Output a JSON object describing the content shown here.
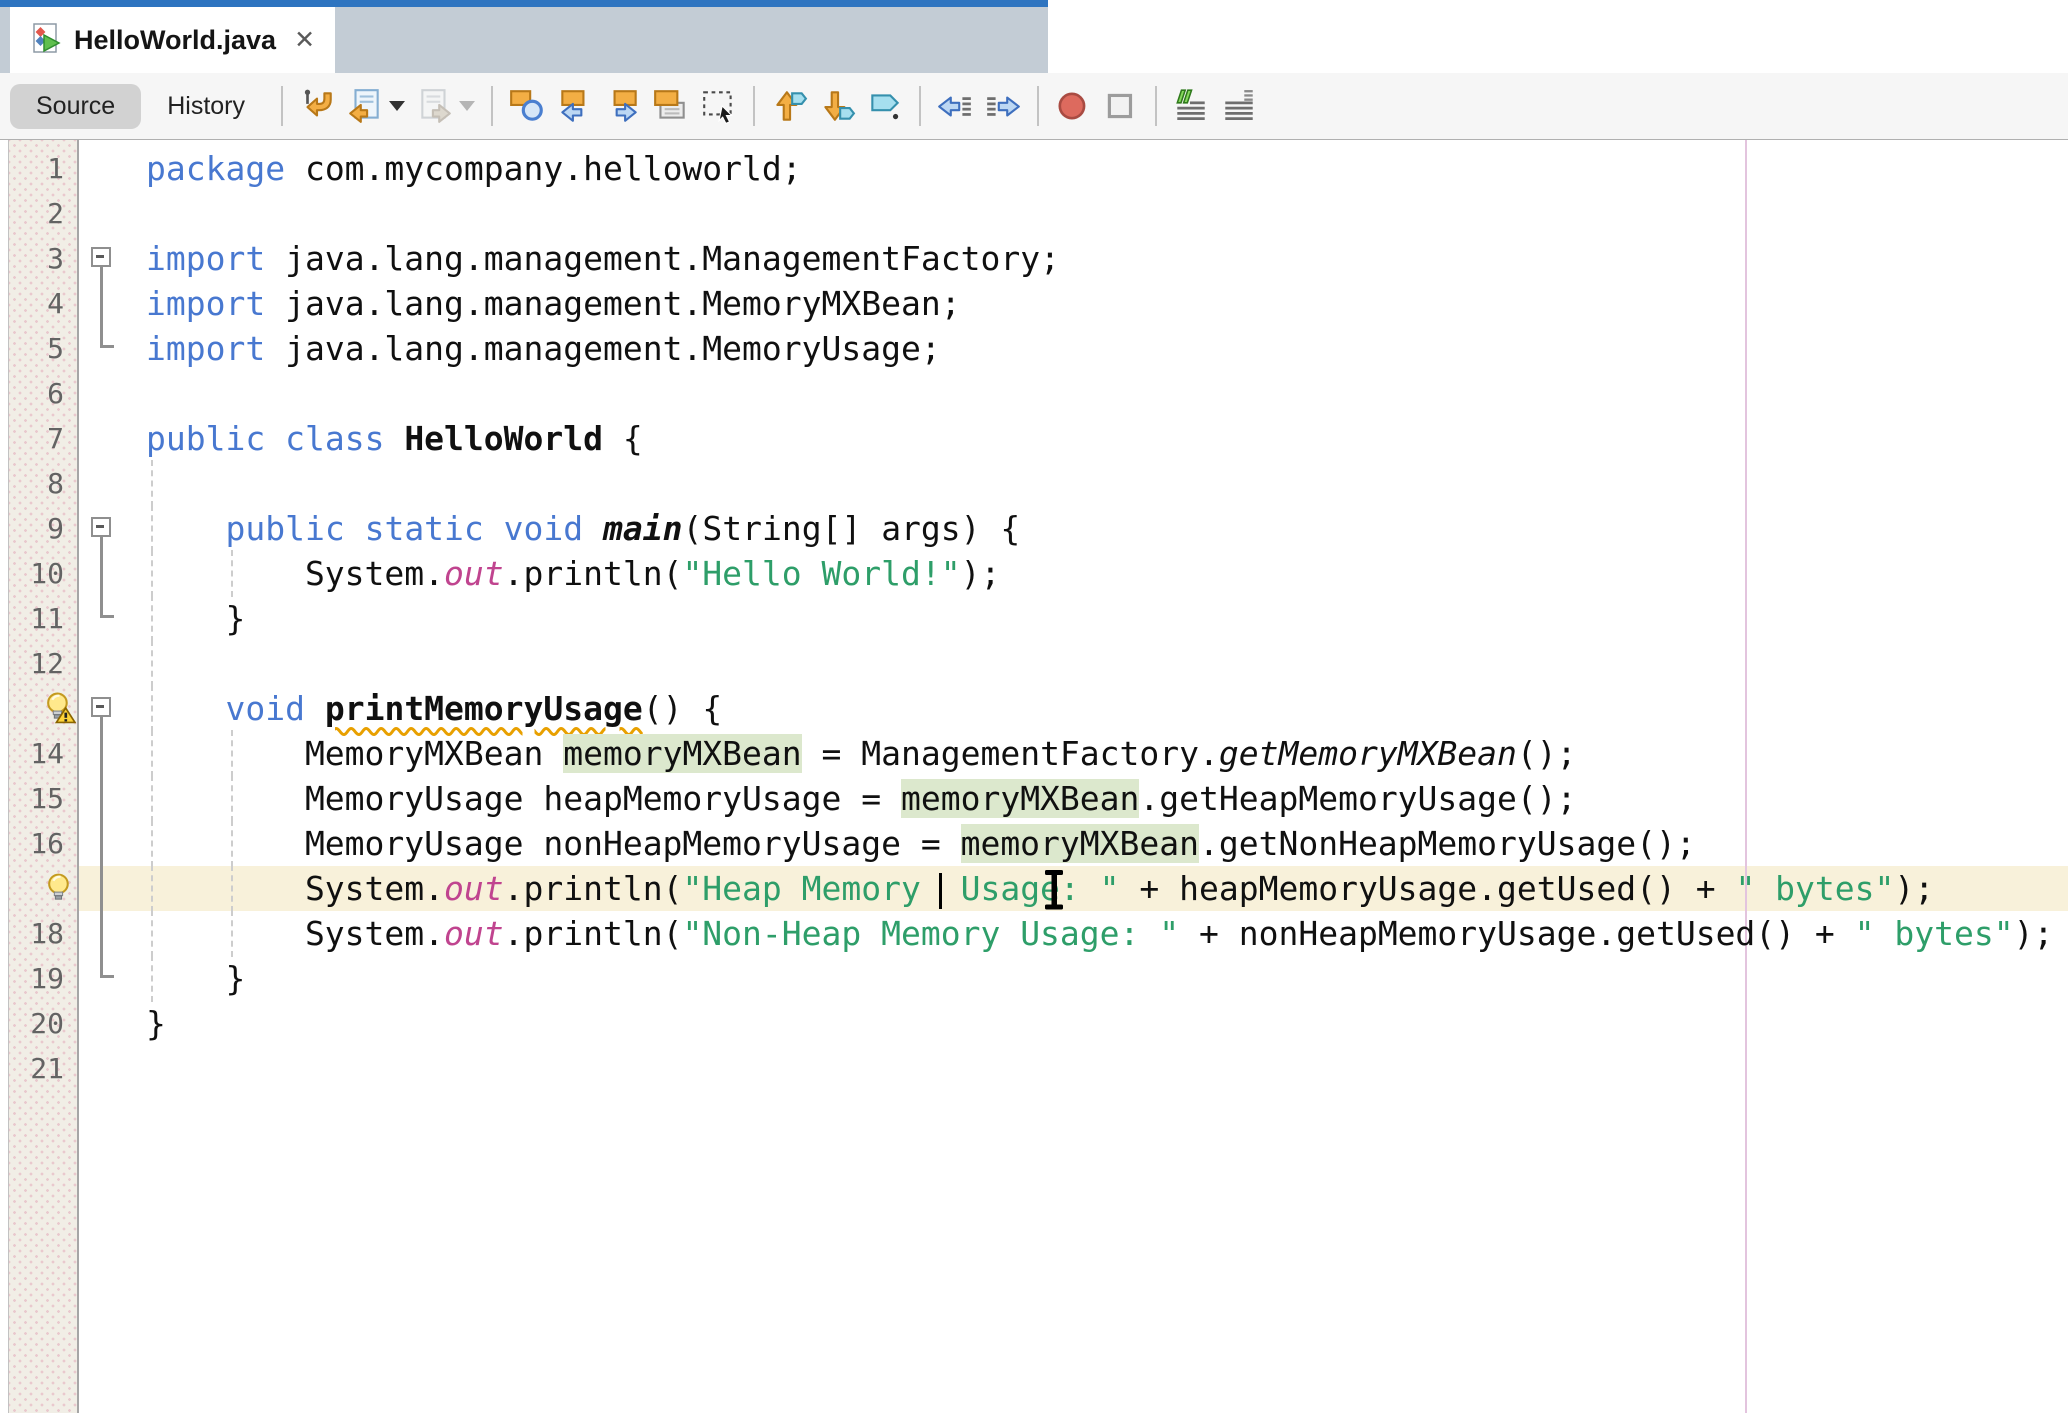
{
  "tab": {
    "title": "HelloWorld.java",
    "close_glyph": "✕",
    "icon": "java-class-icon"
  },
  "view_toggle": {
    "source": "Source",
    "history": "History",
    "selected": "Source"
  },
  "toolbar": {
    "icons": [
      "last-edit-location",
      "back",
      "back-dropdown",
      "forward",
      "forward-dropdown",
      "find-selection",
      "find-previous-occurrence",
      "find-next-occurrence",
      "toggle-highlight-search",
      "toggle-rectangular-selection",
      "previous-bookmark",
      "next-bookmark",
      "toggle-bookmark",
      "shift-line-left",
      "shift-line-right",
      "start-macro-recording",
      "stop-macro-recording",
      "comment",
      "uncomment"
    ],
    "disabled_icons": [
      "forward",
      "forward-dropdown"
    ]
  },
  "colors": {
    "accent_blue": "#2e74c0",
    "tabstrip_bg": "#c3ccd5",
    "keyword": "#4878d0",
    "string": "#2e9e69",
    "static_field": "#c0448f",
    "occurrence_bg": "#dce8cd",
    "current_line_bg": "#f8f1da",
    "margin_line": "#e3c4de",
    "gutter_bg": "#f1eee6",
    "line_number": "#636363",
    "warning_underline": "#e8a000"
  },
  "editor": {
    "language": "java",
    "lines": [
      {
        "n": "1",
        "tokens": [
          [
            "kw",
            "package"
          ],
          [
            "pl",
            " com.mycompany.helloworld;"
          ]
        ],
        "f": "",
        "g": []
      },
      {
        "n": "2",
        "tokens": [],
        "f": "",
        "g": []
      },
      {
        "n": "3",
        "tokens": [
          [
            "kw",
            "import"
          ],
          [
            "pl",
            " java.lang.management.ManagementFactory;"
          ]
        ],
        "f": "s",
        "g": []
      },
      {
        "n": "4",
        "tokens": [
          [
            "kw",
            "import"
          ],
          [
            "pl",
            " java.lang.management.MemoryMXBean;"
          ]
        ],
        "f": "m",
        "g": []
      },
      {
        "n": "5",
        "tokens": [
          [
            "kw",
            "import"
          ],
          [
            "pl",
            " java.lang.management.MemoryUsage;"
          ]
        ],
        "f": "e",
        "g": []
      },
      {
        "n": "6",
        "tokens": [],
        "f": "",
        "g": []
      },
      {
        "n": "7",
        "tokens": [
          [
            "kw",
            "public"
          ],
          [
            "pl",
            " "
          ],
          [
            "kw",
            "class"
          ],
          [
            "pl",
            " "
          ],
          [
            "b",
            "HelloWorld"
          ],
          [
            "pl",
            " {"
          ]
        ],
        "f": "",
        "g": []
      },
      {
        "n": "8",
        "tokens": [],
        "f": "",
        "g": [
          "a"
        ]
      },
      {
        "n": "9",
        "tokens": [
          [
            "pl",
            "    "
          ],
          [
            "kw",
            "public"
          ],
          [
            "pl",
            " "
          ],
          [
            "kw",
            "static"
          ],
          [
            "pl",
            " "
          ],
          [
            "kw",
            "void"
          ],
          [
            "pl",
            " "
          ],
          [
            "bi",
            "main"
          ],
          [
            "pl",
            "(String[] args) {"
          ]
        ],
        "f": "s",
        "g": [
          "a"
        ]
      },
      {
        "n": "10",
        "tokens": [
          [
            "pl",
            "        System."
          ],
          [
            "fld",
            "out"
          ],
          [
            "pl",
            ".println("
          ],
          [
            "str",
            "\"Hello World!\""
          ],
          [
            "pl",
            ");"
          ]
        ],
        "f": "m",
        "g": [
          "a",
          "b"
        ]
      },
      {
        "n": "11",
        "tokens": [
          [
            "pl",
            "    }"
          ]
        ],
        "f": "e",
        "g": [
          "a"
        ]
      },
      {
        "n": "12",
        "tokens": [],
        "f": "",
        "g": [
          "a"
        ]
      },
      {
        "n": "13",
        "tokens": [
          [
            "pl",
            "    "
          ],
          [
            "kw",
            "void"
          ],
          [
            "pl",
            " "
          ],
          [
            "declw",
            "printMemoryUsage"
          ],
          [
            "pl",
            "() {"
          ]
        ],
        "f": "s",
        "g": [
          "a"
        ],
        "ic": "warn"
      },
      {
        "n": "14",
        "tokens": [
          [
            "pl",
            "        MemoryMXBean "
          ],
          [
            "hl",
            "memoryMXBean"
          ],
          [
            "pl",
            " = ManagementFactory."
          ],
          [
            "sit",
            "getMemoryMXBean"
          ],
          [
            "pl",
            "();"
          ]
        ],
        "f": "m",
        "g": [
          "a",
          "b"
        ]
      },
      {
        "n": "15",
        "tokens": [
          [
            "pl",
            "        MemoryUsage heapMemoryUsage = "
          ],
          [
            "hl",
            "memoryMXBean"
          ],
          [
            "pl",
            ".getHeapMemoryUsage();"
          ]
        ],
        "f": "m",
        "g": [
          "a",
          "b"
        ]
      },
      {
        "n": "16",
        "tokens": [
          [
            "pl",
            "        MemoryUsage nonHeapMemoryUsage = "
          ],
          [
            "hl",
            "memoryMXBean"
          ],
          [
            "pl",
            ".getNonHeapMemoryUsage();"
          ]
        ],
        "f": "m",
        "g": [
          "a",
          "b"
        ]
      },
      {
        "n": "17",
        "tokens": [
          [
            "pl",
            "        System."
          ],
          [
            "fld",
            "out"
          ],
          [
            "pl",
            ".println("
          ],
          [
            "str",
            "\"Heap Memory "
          ],
          [
            "caret",
            ""
          ],
          [
            "str",
            " Usage: \""
          ],
          [
            "pl",
            " + heapMemoryUsage.getUsed() + "
          ],
          [
            "str",
            "\" bytes\""
          ],
          [
            "pl",
            ");"
          ]
        ],
        "f": "m",
        "g": [
          "a",
          "b"
        ],
        "ic": "bulb",
        "cur": true
      },
      {
        "n": "18",
        "tokens": [
          [
            "pl",
            "        System."
          ],
          [
            "fld",
            "out"
          ],
          [
            "pl",
            ".println("
          ],
          [
            "str",
            "\"Non-Heap Memory Usage: \""
          ],
          [
            "pl",
            " + nonHeapMemoryUsage.getUsed() + "
          ],
          [
            "str",
            "\" bytes\""
          ],
          [
            "pl",
            ");"
          ]
        ],
        "f": "m",
        "g": [
          "a",
          "b"
        ]
      },
      {
        "n": "19",
        "tokens": [
          [
            "pl",
            "    }"
          ]
        ],
        "f": "e",
        "g": [
          "a"
        ]
      },
      {
        "n": "20",
        "tokens": [
          [
            "pl",
            "}"
          ]
        ],
        "f": "",
        "g": []
      },
      {
        "n": "21",
        "tokens": [],
        "f": "",
        "g": []
      }
    ]
  }
}
